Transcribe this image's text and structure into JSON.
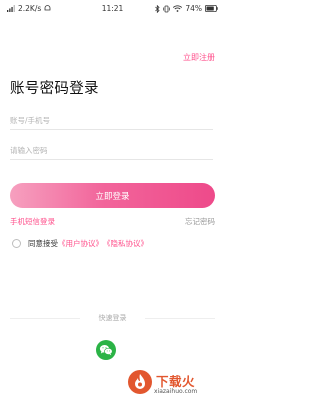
{
  "status_bar": {
    "network_speed": "2.2K/s",
    "time": "11:21",
    "battery": "74%"
  },
  "header": {
    "register_link": "立即注册"
  },
  "title": "账号密码登录",
  "form": {
    "account_placeholder": "账号/手机号",
    "password_placeholder": "请输入密码",
    "login_button": "立即登录"
  },
  "links": {
    "sms_login": "手机短信登录",
    "forgot_password": "忘记密码"
  },
  "agreement": {
    "prefix": "同意接受",
    "user_agreement": "《用户协议》",
    "privacy_policy": "《隐私协议》"
  },
  "quick_login": {
    "label": "快速登录"
  },
  "watermark": {
    "brand": "下载火",
    "site": "xiazaihuo.com"
  },
  "colors": {
    "accent": "#ff4f8b",
    "wechat": "#2bb346"
  }
}
